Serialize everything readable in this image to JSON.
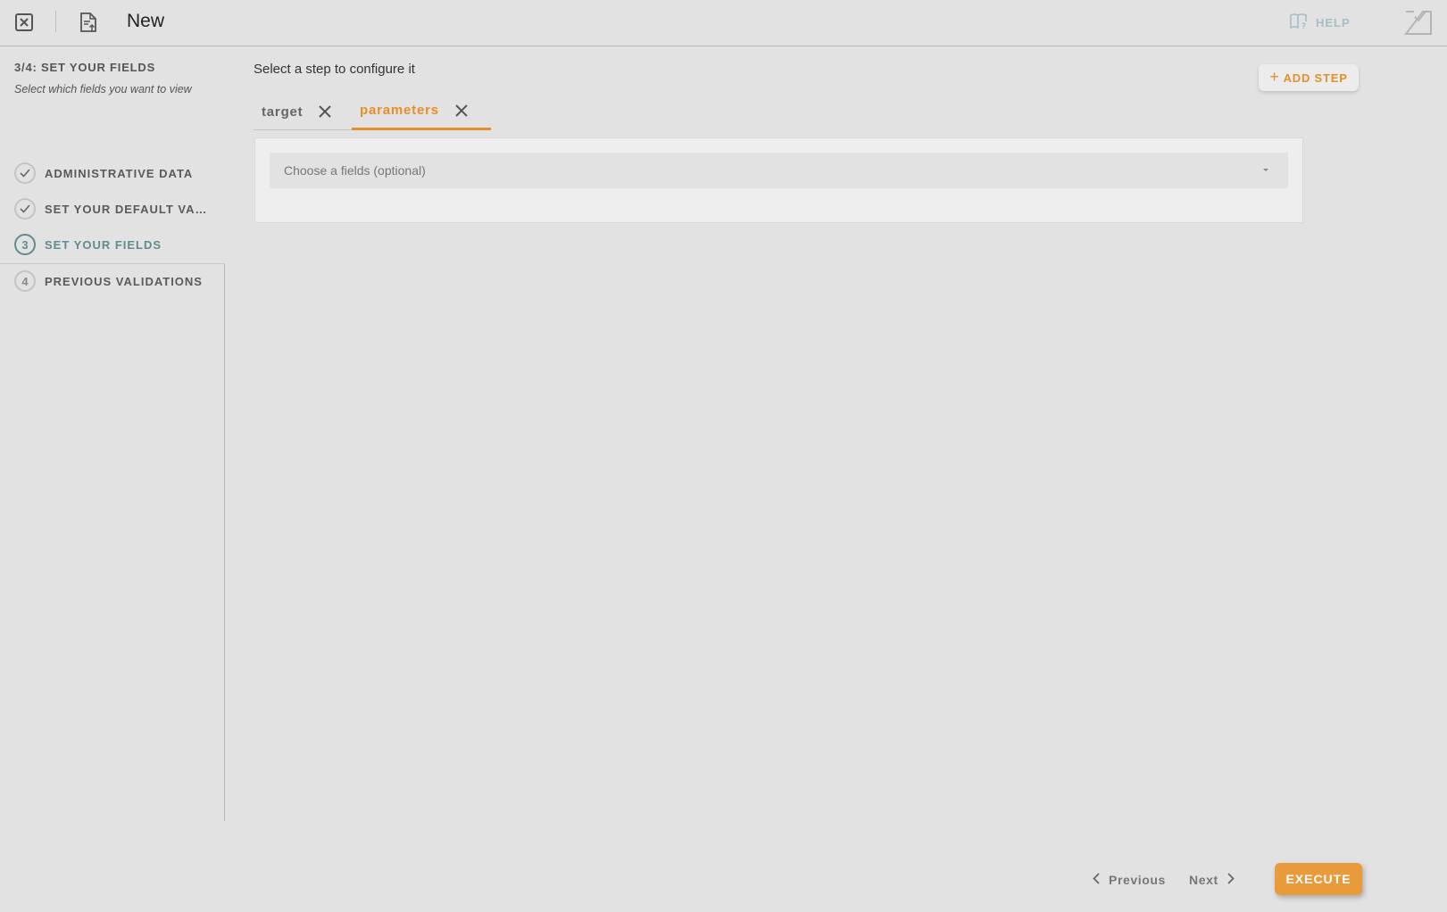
{
  "header": {
    "title": "New",
    "help_label": "HELP"
  },
  "sidebar": {
    "step_heading": "3/4: SET YOUR FIELDS",
    "step_subtitle": "Select which fields you want to view",
    "items": [
      {
        "number": "",
        "label": "ADMINISTRATIVE DATA",
        "state": "done"
      },
      {
        "number": "",
        "label": "SET YOUR DEFAULT VALUES",
        "state": "done"
      },
      {
        "number": "3",
        "label": "SET YOUR FIELDS",
        "state": "active"
      },
      {
        "number": "4",
        "label": "PREVIOUS VALIDATIONS",
        "state": "pending"
      }
    ]
  },
  "main": {
    "title": "Select a step to configure it",
    "add_step_label": "ADD STEP",
    "tabs": [
      {
        "label": "target",
        "active": false
      },
      {
        "label": "parameters",
        "active": true
      }
    ],
    "select_placeholder": "Choose a fields (optional)"
  },
  "footer": {
    "previous_label": "Previous",
    "next_label": "Next",
    "execute_label": "EXECUTE"
  },
  "colors": {
    "accent": "#e58f2c",
    "active_step": "#5f8c90",
    "help": "#a6bdc6",
    "background": "#e2e2e2"
  }
}
